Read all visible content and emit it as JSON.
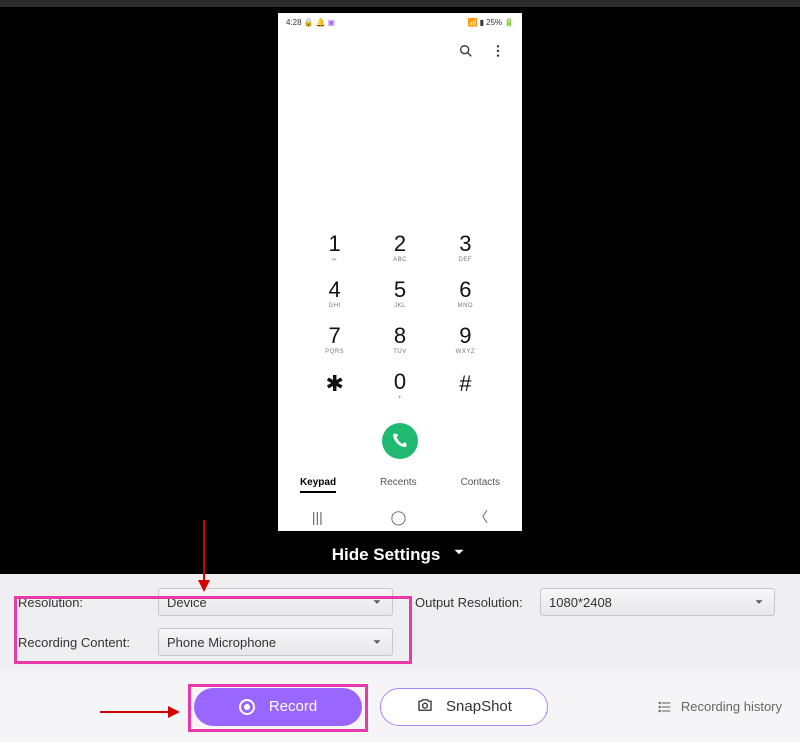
{
  "phone": {
    "status_time": "4:28",
    "status_battery": "25%",
    "keypad": [
      {
        "num": "1",
        "sub": "∞"
      },
      {
        "num": "2",
        "sub": "ABC"
      },
      {
        "num": "3",
        "sub": "DEF"
      },
      {
        "num": "4",
        "sub": "GHI"
      },
      {
        "num": "5",
        "sub": "JKL"
      },
      {
        "num": "6",
        "sub": "MNO"
      },
      {
        "num": "7",
        "sub": "PQRS"
      },
      {
        "num": "8",
        "sub": "TUV"
      },
      {
        "num": "9",
        "sub": "WXYZ"
      },
      {
        "num": "✱",
        "sub": ""
      },
      {
        "num": "0",
        "sub": "+"
      },
      {
        "num": "#",
        "sub": ""
      }
    ],
    "tabs": {
      "keypad": "Keypad",
      "recents": "Recents",
      "contacts": "Contacts"
    }
  },
  "toggle": {
    "hide_settings": "Hide Settings"
  },
  "settings": {
    "resolution_label": "Resolution:",
    "resolution_value": "Device",
    "recording_content_label": "Recording Content:",
    "recording_content_value": "Phone Microphone",
    "output_resolution_label": "Output Resolution:",
    "output_resolution_value": "1080*2408"
  },
  "actions": {
    "record": "Record",
    "snapshot": "SnapShot",
    "history": "Recording history"
  }
}
